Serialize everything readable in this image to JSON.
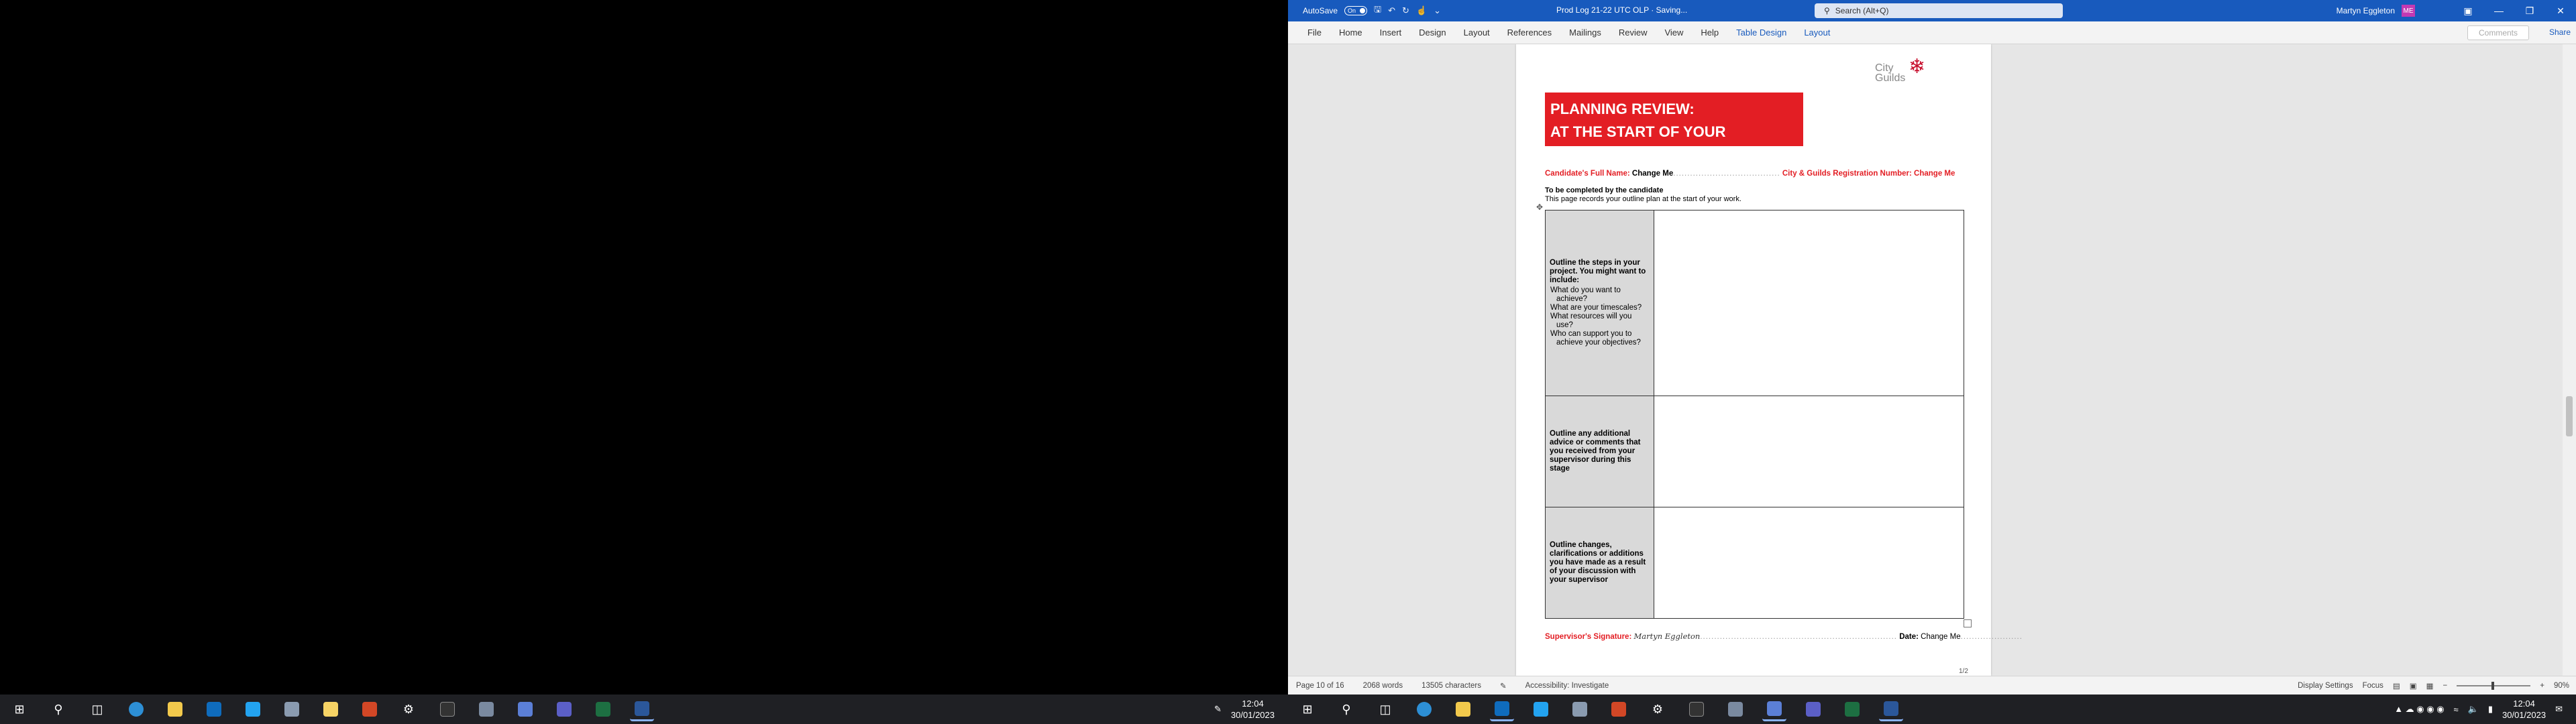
{
  "colors": {
    "accent": "#185abd",
    "banner_red": "#e31e24",
    "taskbar": "#1f2024"
  },
  "titlebar": {
    "autosave_label": "AutoSave",
    "autosave_state": "On",
    "document_title": "Prod Log 21-22 UTC OLP  ·  Saving...",
    "search_placeholder": "Search (Alt+Q)",
    "user_name": "Martyn Eggleton",
    "user_initials": "ME"
  },
  "ribbon": {
    "tabs": [
      "File",
      "Home",
      "Insert",
      "Design",
      "Layout",
      "References",
      "Mailings",
      "Review",
      "View",
      "Help",
      "Table Design",
      "Layout"
    ],
    "comments_label": "Comments",
    "share_label": "Share"
  },
  "document": {
    "logo_text_line1": "City",
    "logo_text_line2": "Guilds",
    "banner_line1": "PLANNING REVIEW:",
    "banner_line2": "AT THE START OF YOUR PROJECT",
    "candidate_label": "Candidate's Full Name: ",
    "candidate_value": "Change Me",
    "candidate_dots": "......................................",
    "reg_label": "City & Guilds Registration Number: ",
    "reg_value": "Change Me",
    "completed_by": "To be completed by the candidate",
    "records_text": "This page records your outline plan at the start of your work.",
    "row1_heading": "Outline the steps in your project. You might want to include:",
    "row1_bullets": [
      "What do you want to achieve?",
      "What are your timescales?",
      "What resources will you use?",
      "Who can support you to achieve your objectives?"
    ],
    "row2_heading": "Outline any additional advice or comments that you received from your supervisor during this stage",
    "row3_heading": "Outline changes, clarifications or additions you have made as a result of your discussion with your supervisor",
    "sig_label": "Supervisor's Signature: ",
    "sig_value": "Martyn Eggleton",
    "sig_dots": "......................................................................",
    "date_label": "Date: ",
    "date_value": "Change Me",
    "date_dots": "......................",
    "page_number": "1/2"
  },
  "statusbar": {
    "page": "Page 10 of 16",
    "words": "2068 words",
    "characters": "13505 characters",
    "accessibility": "Accessibility: Investigate",
    "display_settings": "Display Settings",
    "focus": "Focus",
    "zoom": "90%"
  },
  "taskbar_left": {
    "time": "12:04",
    "date": "30/01/2023"
  },
  "taskbar_right": {
    "time": "12:04",
    "date": "30/01/2023"
  }
}
